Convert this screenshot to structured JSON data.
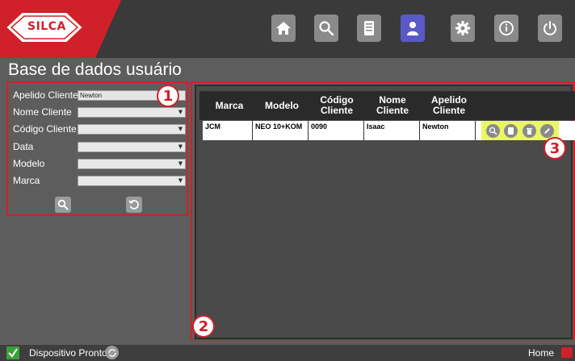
{
  "header": {
    "logo_text": "SILCA",
    "nav": [
      {
        "name": "home",
        "icon": "home-icon",
        "active": false
      },
      {
        "name": "search",
        "icon": "search-icon",
        "active": false
      },
      {
        "name": "database",
        "icon": "key-database-icon",
        "active": false
      },
      {
        "name": "users",
        "icon": "user-icon",
        "active": true
      },
      {
        "name": "settings",
        "icon": "gear-icon",
        "active": false
      },
      {
        "name": "info",
        "icon": "info-icon",
        "active": false
      },
      {
        "name": "power",
        "icon": "power-icon",
        "active": false
      }
    ]
  },
  "page": {
    "title": "Base de dados usuário"
  },
  "filters": [
    {
      "label": "Apelido Cliente",
      "value": "Newton",
      "type": "text"
    },
    {
      "label": "Nome Cliente",
      "value": "",
      "type": "select"
    },
    {
      "label": "Código Cliente",
      "value": "",
      "type": "select"
    },
    {
      "label": "Data",
      "value": "",
      "type": "select"
    },
    {
      "label": "Modelo",
      "value": "",
      "type": "select"
    },
    {
      "label": "Marca",
      "value": "",
      "type": "select"
    }
  ],
  "badges": {
    "one": "1",
    "two": "2",
    "three": "3"
  },
  "table": {
    "columns": [
      "Marca",
      "Modelo",
      "Código\nCliente",
      "Nome\nCliente",
      "Apelido\nCliente"
    ],
    "rows": [
      {
        "marca": "JCM",
        "modelo": "NEO 10+KOM",
        "codigo": "0090",
        "nome": "Isaac",
        "apelido": "Newton"
      }
    ]
  },
  "status": {
    "text": "Dispositivo Pronto",
    "home": "Home"
  },
  "colors": {
    "accent": "#d0202a",
    "active_nav": "#5a59c8",
    "highlight": "#eaf56a"
  }
}
